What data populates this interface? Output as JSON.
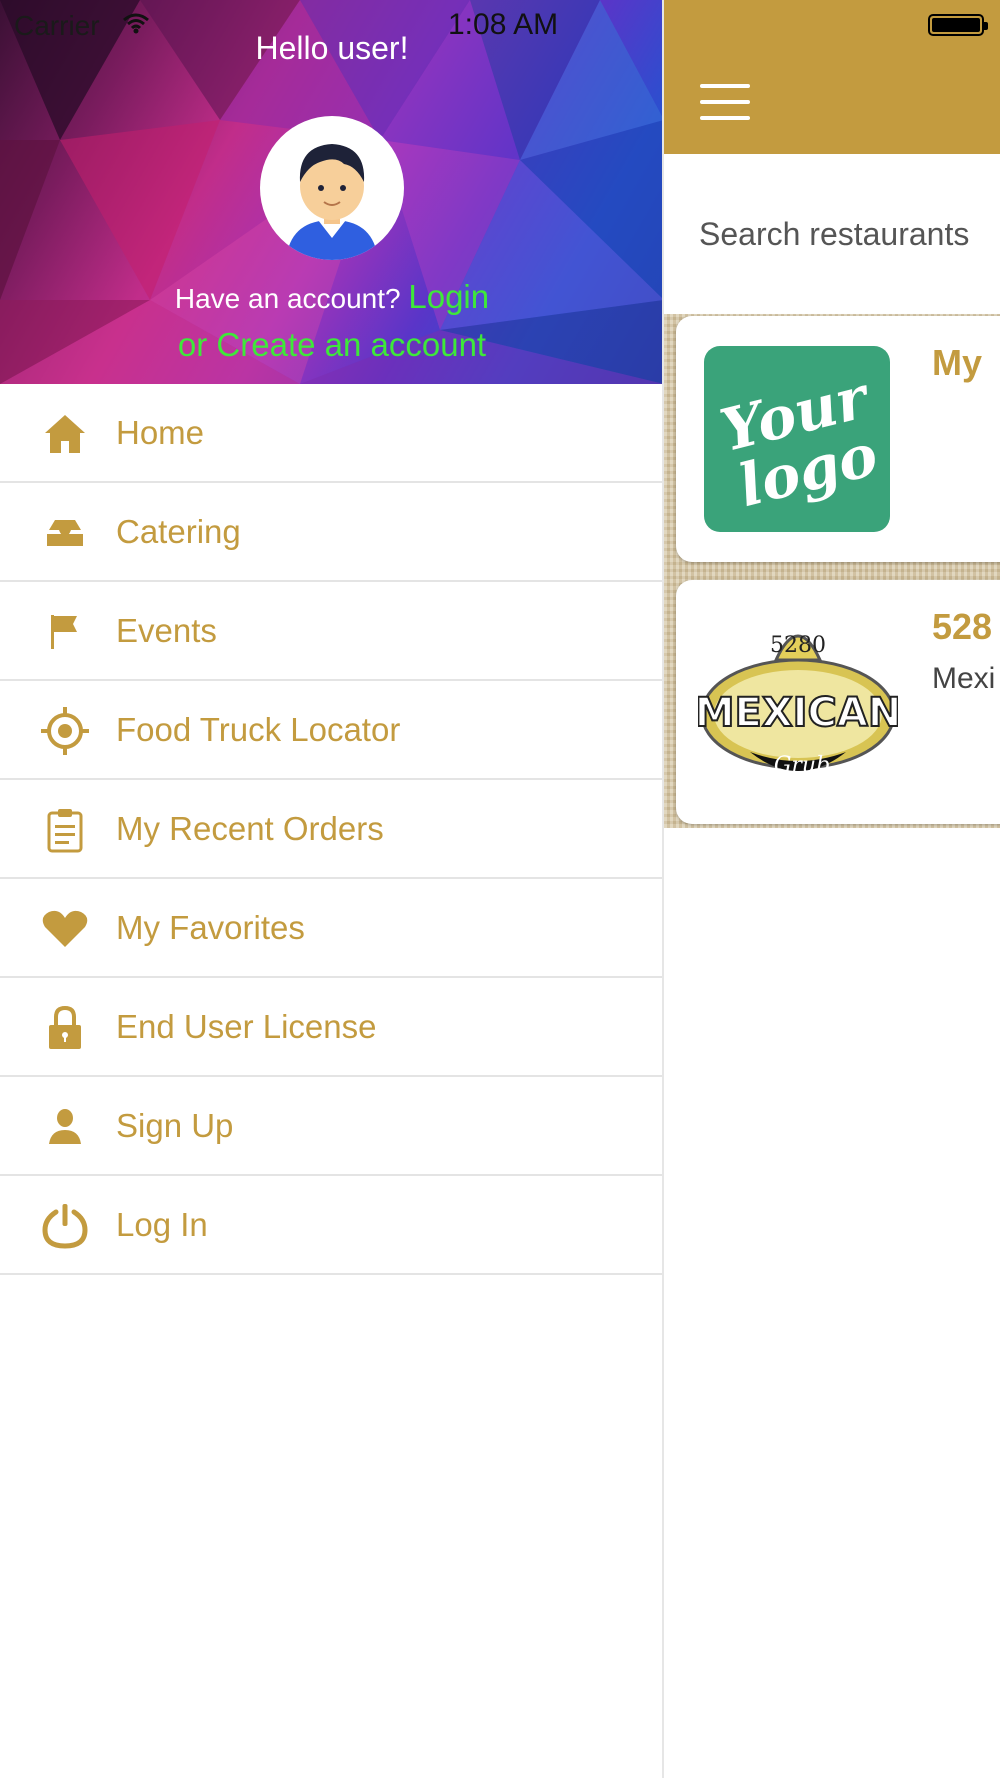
{
  "status_bar": {
    "carrier": "Carrier",
    "time": "1:08 AM"
  },
  "drawer": {
    "greeting": "Hello user!",
    "account_prompt": "Have an account?",
    "login_link": "Login",
    "create_link": "or Create an account",
    "menu_items": [
      {
        "label": "Home",
        "icon": "home-icon"
      },
      {
        "label": "Catering",
        "icon": "catering-tray-icon"
      },
      {
        "label": "Events",
        "icon": "flag-icon"
      },
      {
        "label": "Food Truck Locator",
        "icon": "locator-target-icon"
      },
      {
        "label": "My Recent Orders",
        "icon": "clipboard-icon"
      },
      {
        "label": "My Favorites",
        "icon": "heart-icon"
      },
      {
        "label": "End User License",
        "icon": "lock-icon"
      },
      {
        "label": "Sign Up",
        "icon": "user-icon"
      },
      {
        "label": "Log In",
        "icon": "power-icon"
      }
    ]
  },
  "main": {
    "search_placeholder": "Search restaurants",
    "restaurants": [
      {
        "name": "My",
        "subtitle": "",
        "logo_text": "Your logo"
      },
      {
        "name": "528",
        "subtitle": "Mexi",
        "logo_text": "5280 MEXICAN Grub"
      }
    ]
  },
  "colors": {
    "accent_gold": "#c39b3f",
    "link_green": "#3ee83a",
    "logo_green": "#3aa37a"
  }
}
